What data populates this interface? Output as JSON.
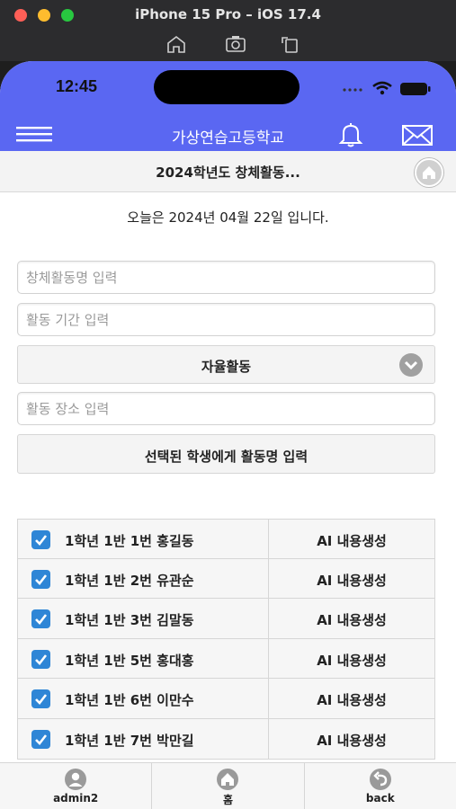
{
  "simulator": {
    "title": "iPhone 15 Pro – iOS 17.4",
    "tools": [
      "home-icon",
      "screenshot-icon",
      "rotate-icon"
    ]
  },
  "status_bar": {
    "time": "12:45"
  },
  "appbar": {
    "title": "가상연습고등학교"
  },
  "subheader": {
    "title": "2024학년도 창체활동..."
  },
  "today": "오늘은 2024년 04월 22일 입니다.",
  "form": {
    "activity_name_placeholder": "창체활동명 입력",
    "activity_period_placeholder": "활동 기간 입력",
    "activity_type": "자율활동",
    "activity_place_placeholder": "활동 장소 입력",
    "apply_button": "선택된 학생에게 활동명 입력"
  },
  "students": [
    {
      "name": "1학년 1반 1번 홍길동",
      "checked": true,
      "action": "AI 내용생성"
    },
    {
      "name": "1학년 1반 2번 유관순",
      "checked": true,
      "action": "AI 내용생성"
    },
    {
      "name": "1학년 1반 3번 김말동",
      "checked": true,
      "action": "AI 내용생성"
    },
    {
      "name": "1학년 1반 5번 홍대홍",
      "checked": true,
      "action": "AI 내용생성"
    },
    {
      "name": "1학년 1반 6번 이만수",
      "checked": true,
      "action": "AI 내용생성"
    },
    {
      "name": "1학년 1반 7번 박만길",
      "checked": true,
      "action": "AI 내용생성"
    }
  ],
  "footer": {
    "user_label": "admin2",
    "home_label": "홈",
    "back_label": "back"
  },
  "colors": {
    "accent": "#5a67f2",
    "checkbox": "#2f86d6"
  }
}
